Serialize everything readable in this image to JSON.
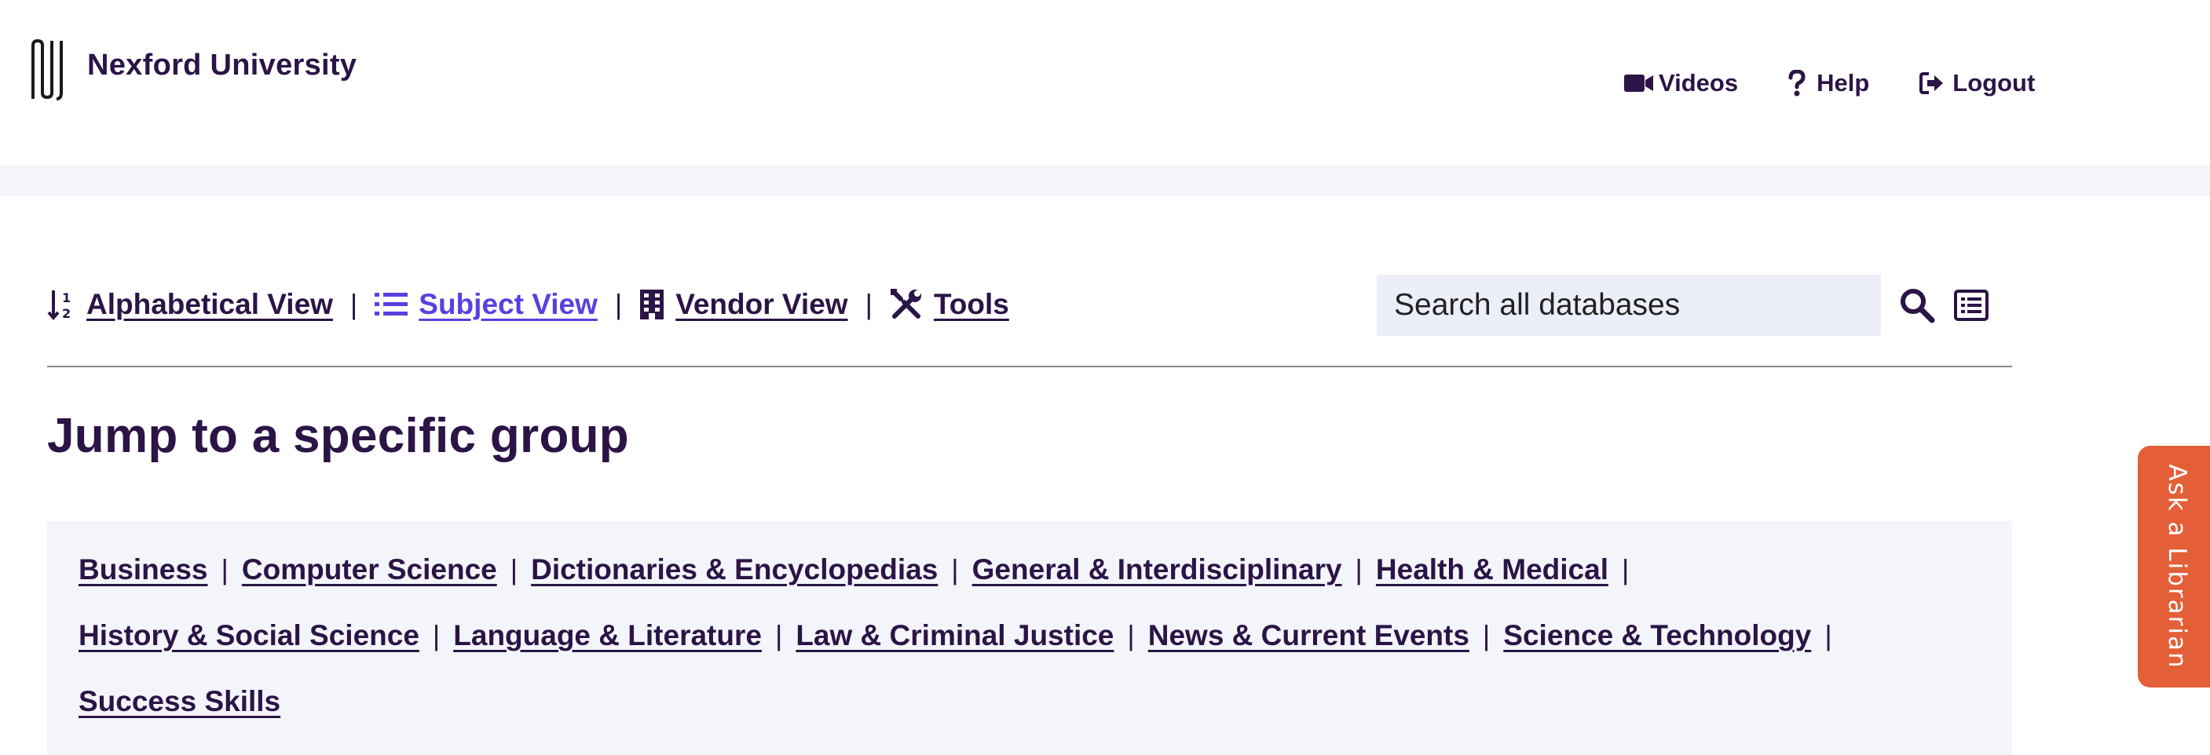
{
  "header": {
    "brand": "Nexford University",
    "nav": [
      {
        "label": "Videos",
        "icon": "video-icon"
      },
      {
        "label": "Help",
        "icon": "question-icon"
      },
      {
        "label": "Logout",
        "icon": "logout-icon"
      }
    ]
  },
  "views": [
    {
      "label": "Alphabetical View",
      "icon": "sort-alpha-icon",
      "active": false
    },
    {
      "label": "Subject View",
      "icon": "list-icon",
      "active": true
    },
    {
      "label": "Vendor View",
      "icon": "building-icon",
      "active": false
    },
    {
      "label": "Tools",
      "icon": "tools-icon",
      "active": false
    }
  ],
  "search": {
    "placeholder": "Search all databases"
  },
  "page": {
    "heading": "Jump to a specific group"
  },
  "groups": {
    "row1": [
      "Business",
      "Computer Science",
      "Dictionaries & Encyclopedias",
      "General & Interdisciplinary",
      "Health & Medical"
    ],
    "row2": [
      "History & Social Science",
      "Language & Literature",
      "Law & Criminal Justice",
      "News & Current Events",
      "Science & Technology"
    ],
    "row3": [
      "Success Skills"
    ]
  },
  "widget": {
    "ask_label": "Ask a Librarian"
  },
  "colors": {
    "text": "#2b1446",
    "active_link": "#5a3fe0",
    "panel_bg": "#f4f5fb",
    "search_bg": "#eceffa",
    "ask_tab": "#e45f37"
  }
}
